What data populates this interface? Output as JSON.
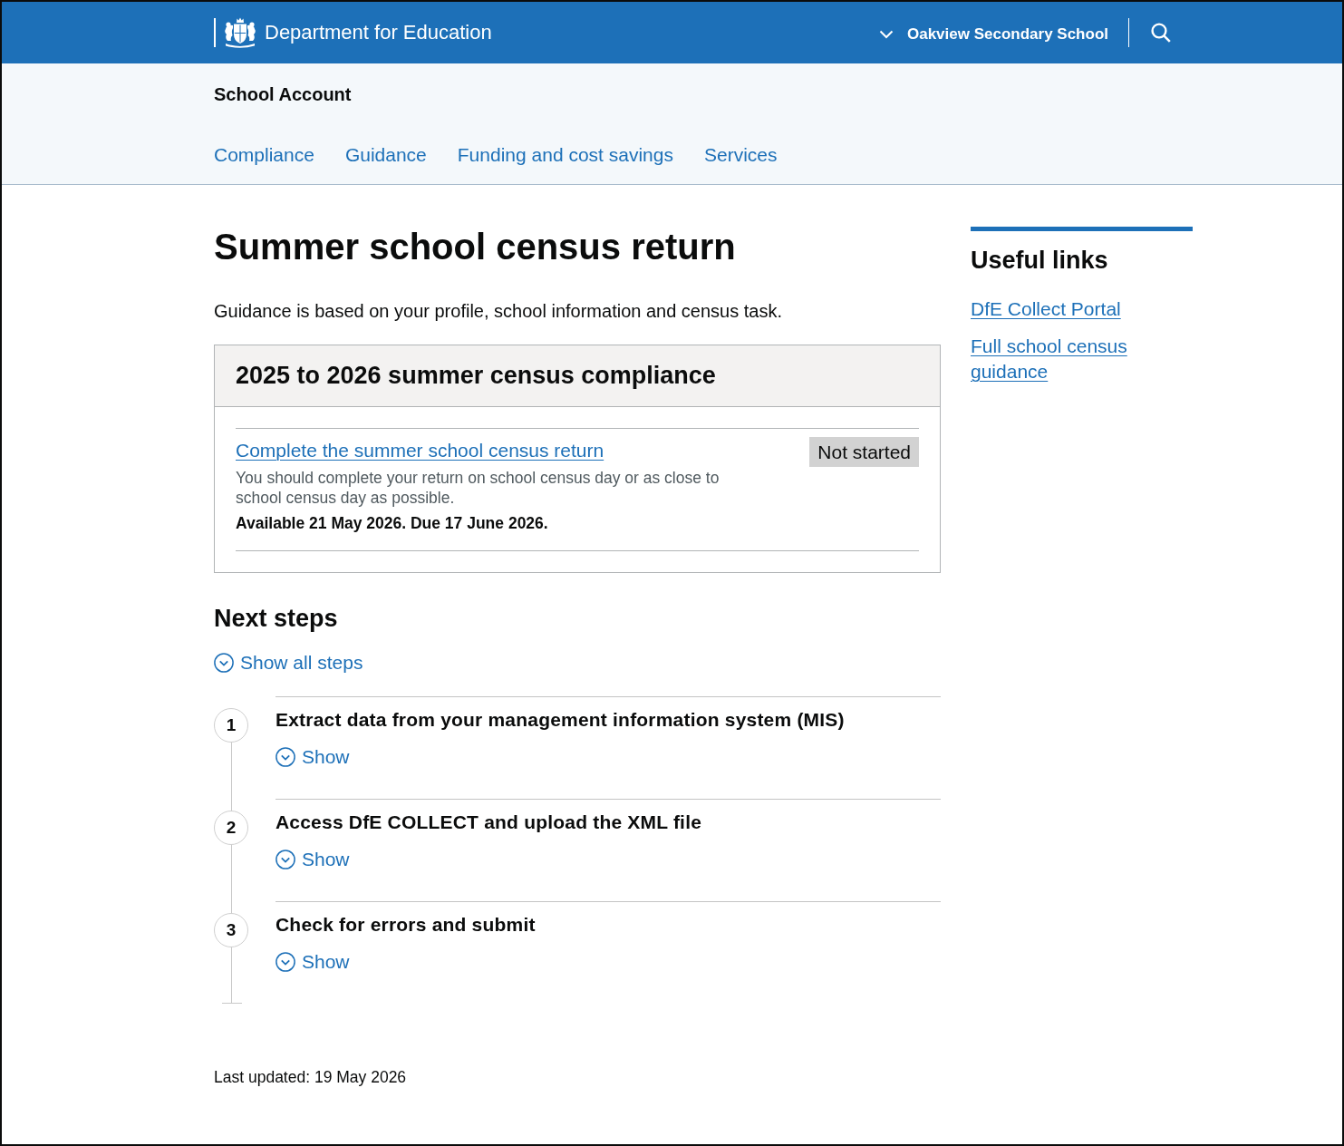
{
  "header": {
    "organisation": "Department for Education",
    "account_menu": {
      "label": "Oakview Secondary School",
      "expanded": false
    }
  },
  "service": {
    "name": "School Account",
    "nav": [
      {
        "label": "Compliance",
        "selected": false
      },
      {
        "label": "Guidance",
        "selected": false
      },
      {
        "label": "Funding and cost savings",
        "selected": false
      },
      {
        "label": "Services",
        "selected": false
      }
    ]
  },
  "page": {
    "title": "Summer school census return",
    "intro": "Guidance is based on your profile, school information and census task."
  },
  "compliance": {
    "title": "2025 to 2026 summer census compliance",
    "tasks": [
      {
        "link": "Complete the summer school census return",
        "status": "Not started",
        "description": "You should complete your return on school census day or as close to school census day as possible.",
        "dates": "Available 21 May 2026. Due 17 June 2026."
      }
    ]
  },
  "next_steps": {
    "title": "Next steps",
    "show_all": {
      "label": "Show all steps",
      "expanded": false
    },
    "steps": [
      {
        "number": "1",
        "title": "Extract data from your management information system (MIS)",
        "toggle": "Show",
        "expanded": false
      },
      {
        "number": "2",
        "title": "Access DfE COLLECT and upload the XML file",
        "toggle": "Show",
        "expanded": false
      },
      {
        "number": "3",
        "title": "Check for errors and submit",
        "toggle": "Show",
        "expanded": false
      }
    ]
  },
  "useful_links": {
    "title": "Useful links",
    "links": [
      "DfE Collect Portal",
      "Full school census guidance"
    ]
  },
  "footer": {
    "last_updated": "Last updated: 19 May 2026"
  }
}
